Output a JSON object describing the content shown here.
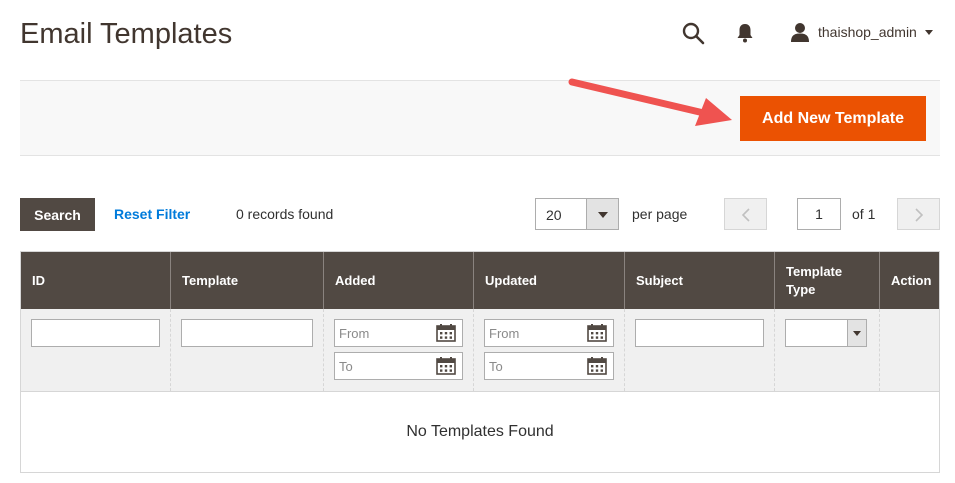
{
  "header": {
    "title": "Email Templates",
    "user_name": "thaishop_admin",
    "icons": [
      "search-icon",
      "bell-icon",
      "user-icon",
      "caret-down-icon"
    ]
  },
  "actions": {
    "add_label": "Add New Template",
    "add_color": "#eb5202"
  },
  "toolbar": {
    "search_label": "Search",
    "reset_label": "Reset Filter",
    "records_text": "0 records found",
    "per_page_value": "20",
    "per_page_label": "per page",
    "page_value": "1",
    "of_label": "of 1"
  },
  "grid": {
    "columns": [
      {
        "label": "ID"
      },
      {
        "label": "Template"
      },
      {
        "label": "Added"
      },
      {
        "label": "Updated"
      },
      {
        "label": "Subject"
      },
      {
        "label": "Template Type"
      },
      {
        "label": "Action"
      }
    ],
    "filters": {
      "added_from": "From",
      "added_to": "To",
      "updated_from": "From",
      "updated_to": "To"
    },
    "empty_text": "No Templates Found",
    "header_color": "#514943"
  }
}
